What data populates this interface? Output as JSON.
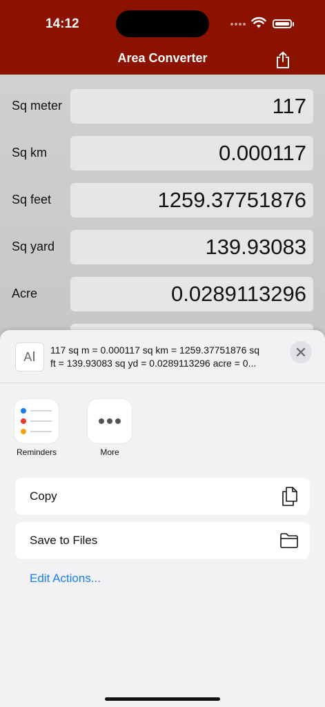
{
  "status": {
    "time": "14:12"
  },
  "nav": {
    "title": "Area Converter"
  },
  "converter": {
    "rows": [
      {
        "label": "Sq meter",
        "value": "117"
      },
      {
        "label": "Sq km",
        "value": "0.000117"
      },
      {
        "label": "Sq feet",
        "value": "1259.37751876"
      },
      {
        "label": "Sq yard",
        "value": "139.93083"
      },
      {
        "label": "Acre",
        "value": "0.0289113296"
      }
    ]
  },
  "share_sheet": {
    "preview_line1": "117 sq m = 0.000117 sq km = 1259.37751876 sq",
    "preview_line2": "ft = 139.93083 sq yd = 0.0289113296 acre = 0...",
    "apps": [
      {
        "label": "Reminders",
        "icon": "reminders-icon"
      },
      {
        "label": "More",
        "icon": "more-icon"
      }
    ],
    "actions": [
      {
        "label": "Copy",
        "icon": "copy-icon"
      },
      {
        "label": "Save to Files",
        "icon": "folder-icon"
      }
    ],
    "edit_actions": "Edit Actions..."
  },
  "colors": {
    "nav_bg": "#8c1200",
    "accent": "#1a7df0"
  }
}
